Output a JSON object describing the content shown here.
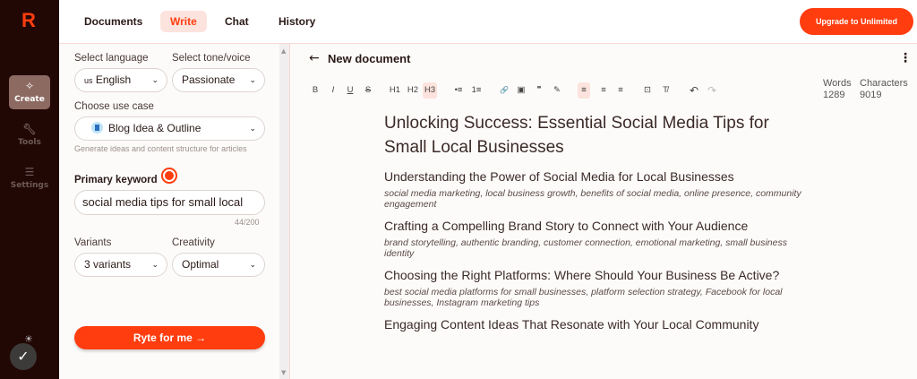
{
  "app": {
    "logo": "R"
  },
  "sidebar": {
    "items": [
      {
        "label": "Create",
        "icon": "sparkles-icon"
      },
      {
        "label": "Tools",
        "icon": "wrench-icon"
      },
      {
        "label": "Settings",
        "icon": "sliders-icon"
      }
    ]
  },
  "topbar": {
    "tabs": [
      "Documents",
      "Write",
      "Chat",
      "History"
    ],
    "active_tab": "Write",
    "upgrade": "Upgrade to Unlimited"
  },
  "form": {
    "language_label": "Select language",
    "language_flag": "us",
    "language_value": "English",
    "tone_label": "Select tone/voice",
    "tone_value": "Passionate",
    "usecase_label": "Choose use case",
    "usecase_value": "Blog Idea & Outline",
    "usecase_hint": "Generate ideas and content structure for articles",
    "keyword_label": "Primary keyword",
    "keyword_value": "social media tips for small local",
    "keyword_count": "44/200",
    "variants_label": "Variants",
    "variants_value": "3 variants",
    "creativity_label": "Creativity",
    "creativity_value": "Optimal",
    "submit": "Ryte for me →"
  },
  "editor": {
    "title": "New document",
    "toolbar": [
      "B",
      "I",
      "U",
      "S",
      "H1",
      "H2",
      "H3",
      "•≡",
      "1≡",
      "🔗",
      "▣",
      "❞",
      "✎",
      "≡",
      "≡",
      "≡",
      "⊡",
      "T̸",
      "↶",
      "↷"
    ],
    "stats": {
      "words_label": "Words",
      "words": "1289",
      "chars_label": "Characters",
      "chars": "9019"
    },
    "doc_title": "Unlocking Success: Essential Social Media Tips for Small Local Businesses",
    "sections": [
      {
        "heading": "Understanding the Power of Social Media for Local Businesses",
        "keywords": "social media marketing, local business growth, benefits of social media, online presence, community engagement"
      },
      {
        "heading": "Crafting a Compelling Brand Story to Connect with Your Audience",
        "keywords": "brand storytelling, authentic branding, customer connection, emotional marketing, small business identity"
      },
      {
        "heading": "Choosing the Right Platforms: Where Should Your Business Be Active?",
        "keywords": "best social media platforms for small businesses, platform selection strategy, Facebook for local businesses, Instagram marketing tips"
      },
      {
        "heading": "Engaging Content Ideas That Resonate with Your Local Community",
        "keywords": ""
      }
    ]
  },
  "colors": {
    "accent": "#ff3d0f",
    "sidebar": "#220805",
    "active_tab_bg": "#fde3dd"
  }
}
